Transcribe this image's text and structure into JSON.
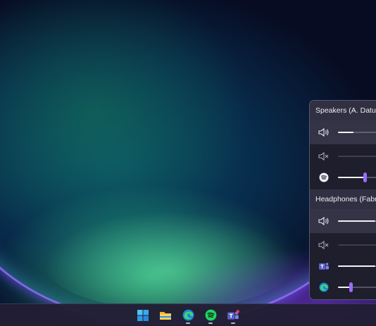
{
  "desktop": {
    "wallpaper": "bloom-wallpaper"
  },
  "mixer": {
    "devices": [
      {
        "name": "Speakers (A. Datum)",
        "master": {
          "icon": "speaker-icon",
          "level": 0.22
        },
        "apps": [
          {
            "icon": "system-sounds-muted-icon",
            "level": 0.0,
            "muted": true
          },
          {
            "icon": "spotify-icon",
            "level": 0.38,
            "thumb": true
          }
        ]
      },
      {
        "name": "Headphones (Fabrikam)",
        "master": {
          "icon": "speaker-icon",
          "level": 0.53
        },
        "apps": [
          {
            "icon": "system-sounds-muted-icon",
            "level": 0.0,
            "muted": true
          },
          {
            "icon": "teams-icon",
            "level": 0.53
          },
          {
            "icon": "edge-icon",
            "level": 0.18,
            "thumb": true
          }
        ]
      }
    ]
  },
  "taskbar": {
    "items": [
      "windows-start-icon",
      "file-explorer-icon",
      "edge-icon",
      "spotify-icon",
      "teams-icon"
    ]
  },
  "colors": {
    "accent": "#9a6cff",
    "panel": "#282a3a"
  }
}
